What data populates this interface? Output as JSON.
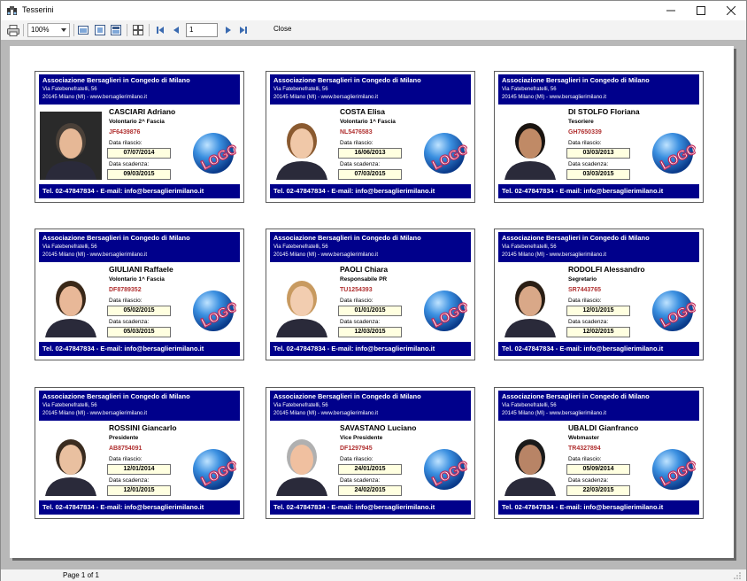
{
  "window": {
    "title": "Tesserini"
  },
  "toolbar": {
    "zoom": "100%",
    "page": "1",
    "close_label": "Close"
  },
  "status": {
    "page_text": "Page 1 of 1"
  },
  "card_common": {
    "org": "Associazione Bersaglieri in Congedo di Milano",
    "address": "Via Fatebenefratelli, 56",
    "city": "20145 Milano (MI) - www.bersaglierimilano.it",
    "issue_label": "Data rilascio:",
    "expiry_label": "Data scadenza:",
    "footer": "Tel. 02-47847834 - E-mail: info@bersaglierimilano.it",
    "logo_text": "LOGO"
  },
  "cards": [
    {
      "name": "CASCIARI Adriano",
      "role": "Volontario 2^ Fascia",
      "code": "JF6439876",
      "issue": "07/07/2014",
      "expiry": "09/03/2015"
    },
    {
      "name": "COSTA Elisa",
      "role": "Volontario 1^ Fascia",
      "code": "NL5476583",
      "issue": "16/06/2013",
      "expiry": "07/03/2015"
    },
    {
      "name": "DI STOLFO Floriana",
      "role": "Tesoriere",
      "code": "GH7650339",
      "issue": "03/03/2013",
      "expiry": "03/03/2015"
    },
    {
      "name": "GIULIANI Raffaele",
      "role": "Volontario 1^ Fascia",
      "code": "DF8789352",
      "issue": "05/02/2015",
      "expiry": "05/03/2015"
    },
    {
      "name": "PAOLI Chiara",
      "role": "Responsabile PR",
      "code": "TU1254393",
      "issue": "01/01/2015",
      "expiry": "12/03/2015"
    },
    {
      "name": "RODOLFI Alessandro",
      "role": "Segretario",
      "code": "SR7443765",
      "issue": "12/01/2015",
      "expiry": "12/02/2015"
    },
    {
      "name": "ROSSINI Giancarlo",
      "role": "Presidente",
      "code": "AB8754091",
      "issue": "12/01/2014",
      "expiry": "12/01/2015"
    },
    {
      "name": "SAVASTANO Luciano",
      "role": "Vice Presidente",
      "code": "DF1297945",
      "issue": "24/01/2015",
      "expiry": "24/02/2015"
    },
    {
      "name": "UBALDI Gianfranco",
      "role": "Webmaster",
      "code": "TR4327894",
      "issue": "05/09/2014",
      "expiry": "22/03/2015"
    }
  ],
  "colors": {
    "card_band": "#00008b",
    "code_text": "#b03030",
    "date_fill": "#ffffe0",
    "viewer_bg": "#b8b8b8"
  },
  "icons": [
    "printer-icon",
    "page-setup-icon",
    "margins-icon",
    "layout-icon",
    "multi-page-icon",
    "first-page-icon",
    "prev-page-icon",
    "next-page-icon",
    "last-page-icon",
    "minimize-icon",
    "maximize-icon",
    "close-icon"
  ]
}
